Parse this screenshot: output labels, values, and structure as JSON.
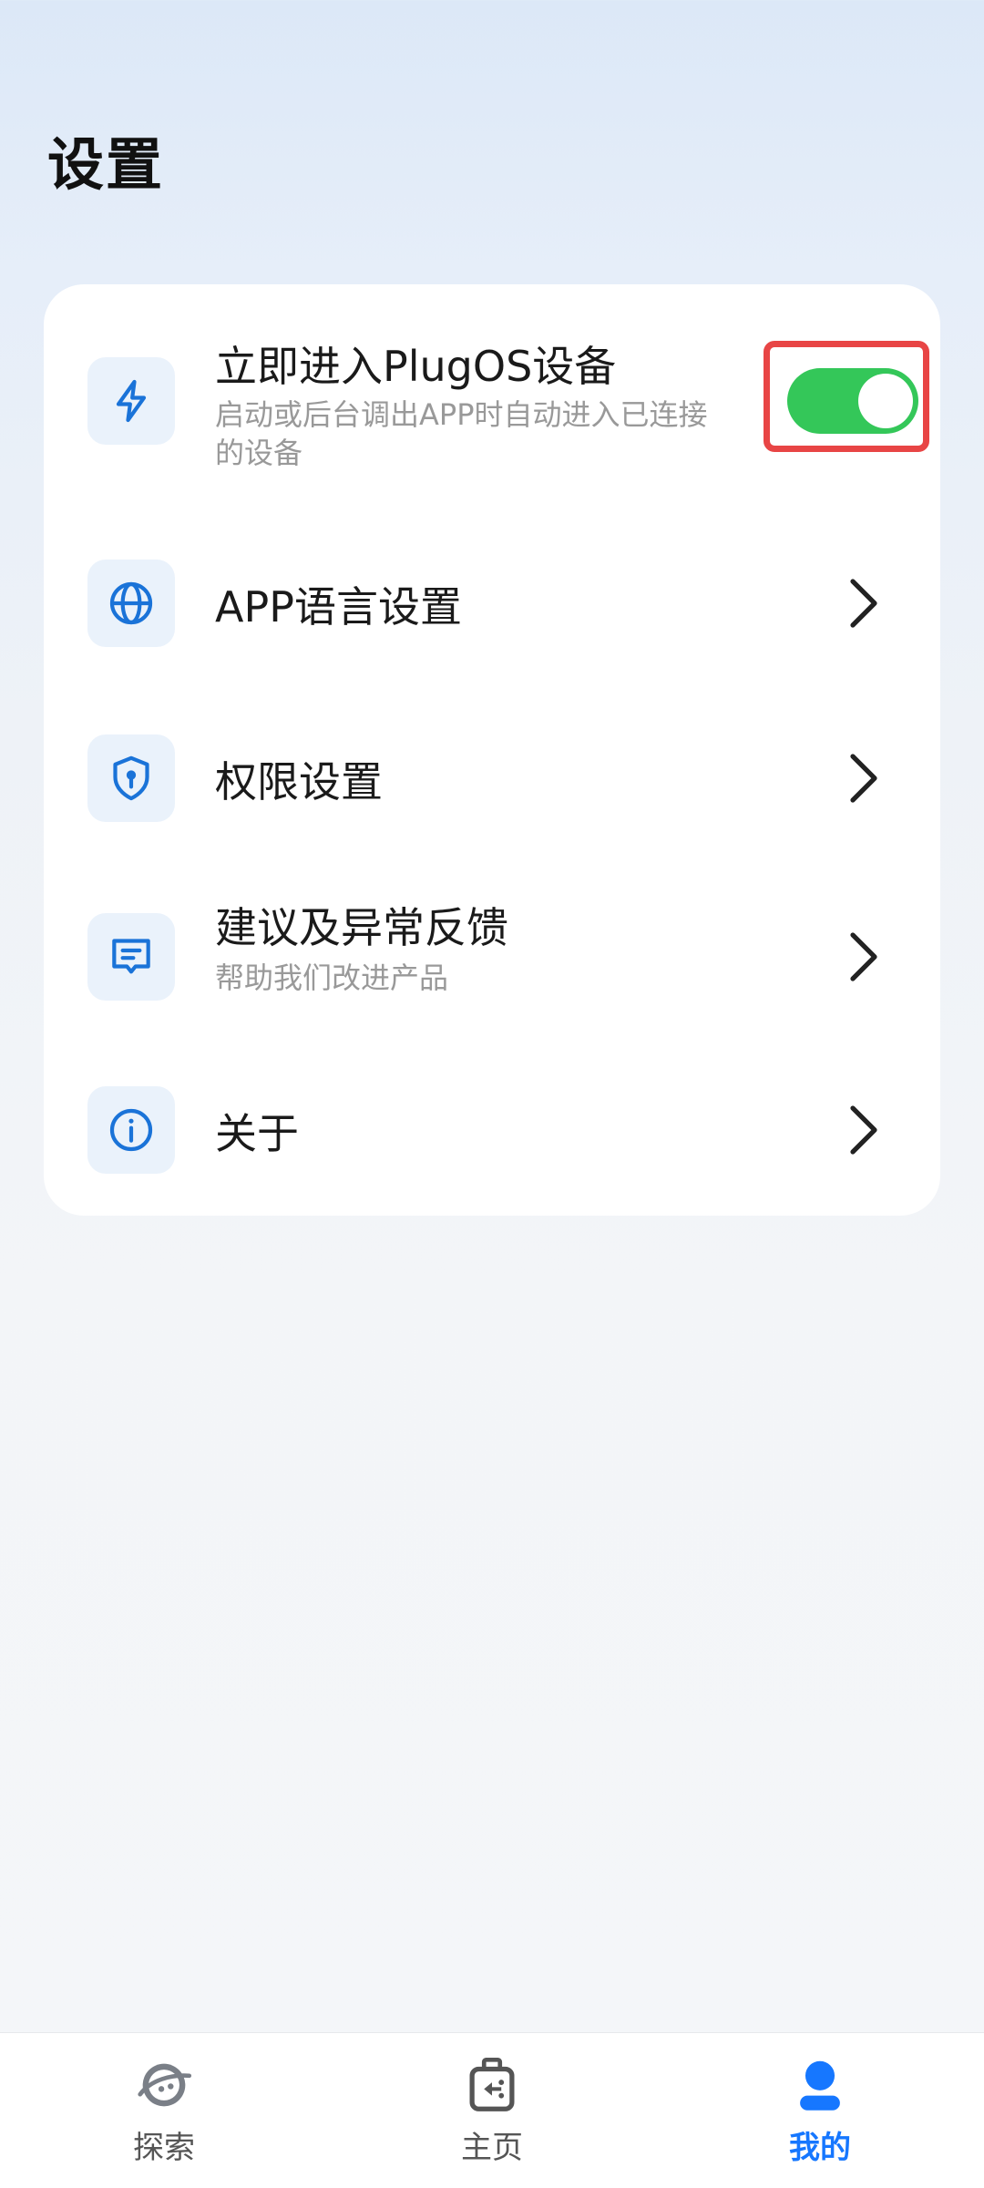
{
  "header": {
    "title": "设置"
  },
  "settings": {
    "auto_enter": {
      "title": "立即进入PlugOS设备",
      "subtitle": "启动或后台调出APP时自动进入已连接的设备",
      "enabled": true,
      "icon": "lightning-icon"
    },
    "language": {
      "title": "APP语言设置",
      "icon": "globe-icon"
    },
    "permissions": {
      "title": "权限设置",
      "icon": "shield-icon"
    },
    "feedback": {
      "title": "建议及异常反馈",
      "subtitle": "帮助我们改进产品",
      "icon": "message-icon"
    },
    "about": {
      "title": "关于",
      "icon": "info-icon"
    }
  },
  "tabbar": {
    "tabs": [
      {
        "label": "探索",
        "icon": "planet-icon",
        "active": false
      },
      {
        "label": "主页",
        "icon": "device-icon",
        "active": false
      },
      {
        "label": "我的",
        "icon": "user-icon",
        "active": true
      }
    ]
  },
  "colors": {
    "accent": "#1677ff",
    "icon_blue": "#1a73d8",
    "toggle_on": "#34c759",
    "highlight": "#e84545"
  }
}
